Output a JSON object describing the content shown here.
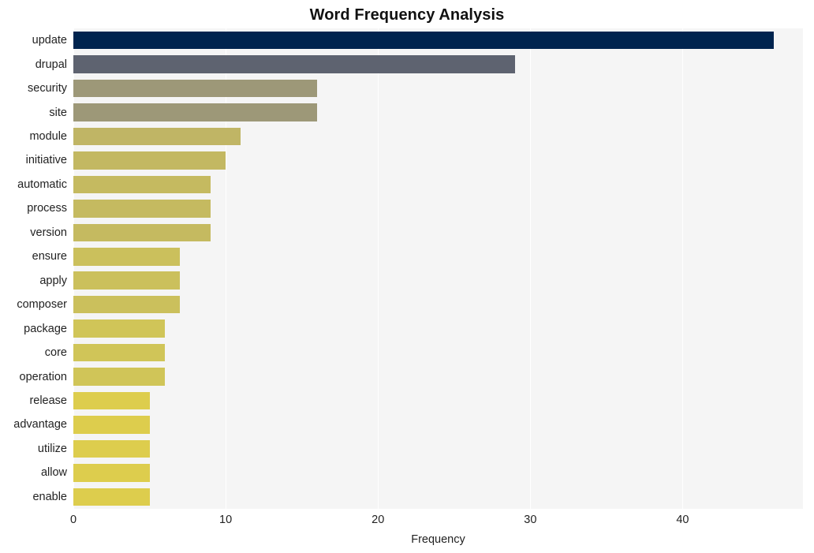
{
  "chart_data": {
    "type": "bar",
    "orientation": "horizontal",
    "title": "Word Frequency Analysis",
    "xlabel": "Frequency",
    "ylabel": "",
    "xlim": [
      0,
      47.9
    ],
    "xticks": [
      0,
      10,
      20,
      30,
      40
    ],
    "xtick_labels": [
      "0",
      "10",
      "20",
      "30",
      "40"
    ],
    "grid": "vertical-white",
    "legend": "none",
    "categories": [
      "update",
      "drupal",
      "security",
      "site",
      "module",
      "initiative",
      "automatic",
      "process",
      "version",
      "ensure",
      "apply",
      "composer",
      "package",
      "core",
      "operation",
      "release",
      "advantage",
      "utilize",
      "allow",
      "enable"
    ],
    "values": [
      46,
      29,
      16,
      16,
      11,
      10,
      9,
      9,
      9,
      7,
      7,
      7,
      6,
      6,
      6,
      5,
      5,
      5,
      5,
      5
    ],
    "bar_colors": [
      "#00244f",
      "#5e6370",
      "#9d9878",
      "#9d9878",
      "#c0b565",
      "#c3b862",
      "#c5ba60",
      "#c5ba60",
      "#c5ba60",
      "#cbc05c",
      "#cbc05c",
      "#cbc05c",
      "#d0c558",
      "#d0c558",
      "#d0c558",
      "#ddcd4d",
      "#ddcd4d",
      "#ddcd4d",
      "#ddcd4d",
      "#ddcd4d"
    ]
  },
  "style": {
    "plot_background": "#f5f5f5",
    "page_background": "#ffffff",
    "gridline_color": "#ffffff",
    "text_color": "#222222",
    "title_color": "#111111"
  }
}
